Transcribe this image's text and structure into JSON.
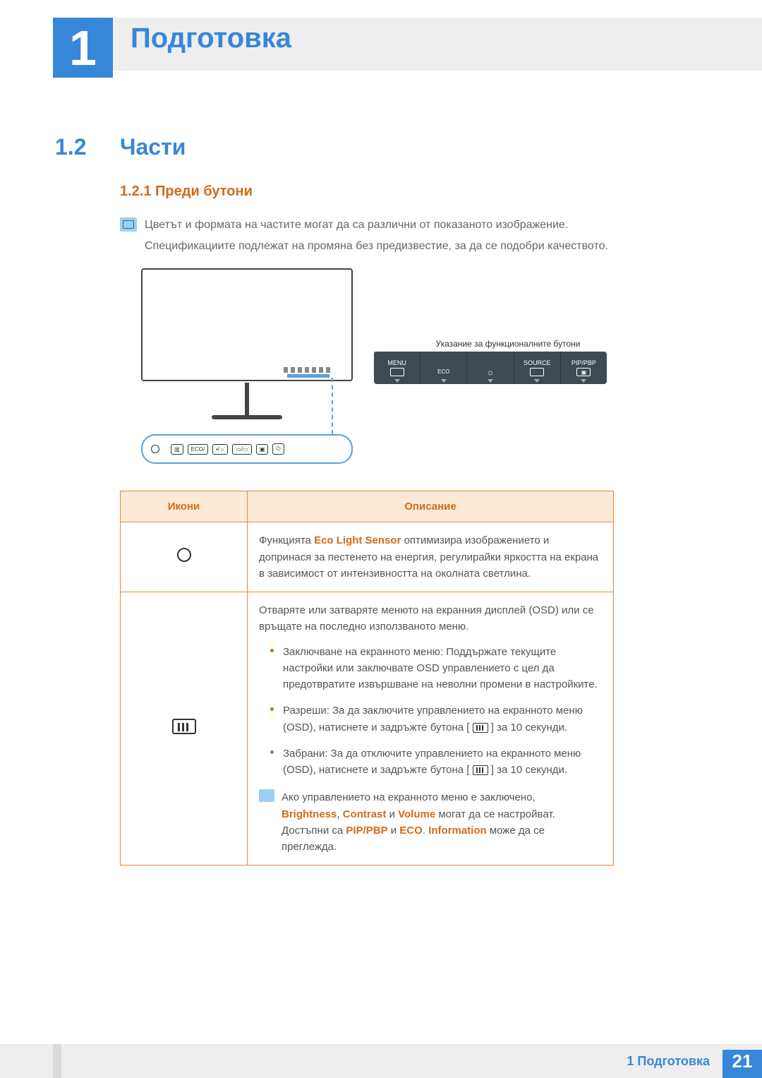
{
  "chapter": {
    "number": "1",
    "title": "Подготовка"
  },
  "section": {
    "number": "1.2",
    "title": "Части"
  },
  "subsection": {
    "full": "1.2.1  Преди бутони"
  },
  "note": {
    "line1": "Цветът и формата на частите могат да са различни от показаното изображение.",
    "line2": "Спецификациите подлежат на промяна без предизвестие, за да се подобри качеството."
  },
  "diagram": {
    "panel_guide": "Указание за функционалните бутони",
    "top_buttons": [
      {
        "label": "MENU"
      },
      {
        "label": "ECO"
      },
      {
        "label": ""
      },
      {
        "label": "SOURCE"
      },
      {
        "label": "PIP/PBP"
      }
    ],
    "bottom_buttons": [
      "",
      "ECO/",
      "/",
      "/",
      "",
      ""
    ]
  },
  "table": {
    "headers": {
      "icons": "Икони",
      "desc": "Описание"
    },
    "rows": [
      {
        "icon": "sensor-circle",
        "desc": {
          "prefix": "Функцията ",
          "hl1": "Eco Light Sensor",
          "rest": " оптимизира изображението и допринася за пестенето на енергия, регулирайки яркостта на екрана в зависимост от интензивността на околната светлина."
        }
      },
      {
        "icon": "menu-rect",
        "desc": {
          "intro": "Отваряте или затваряте менюто на екранния дисплей (OSD) или се връщате на последно използваното меню.",
          "items": [
            "Заключване на екранното меню: Поддържате текущите настройки или заключвате OSD управлението с цел да предотвратите извършване на неволни промени в настройките.",
            "Разреши: За да заключите управлението на екранното меню (OSD), натиснете и задръжте бутона [  ] за 10 секунди.",
            "Забрани: За да отключите управлението на екранното меню (OSD), натиснете и задръжте бутона [  ] за 10 секунди."
          ],
          "note_line1": "Ако управлението на екранното меню е заключено,",
          "note_hl_b": "Brightness",
          "note_hl_c": "Contrast",
          "note_hl_v": "Volume",
          "note_mid": " могат да се настройват. Достъпни са ",
          "note_hl_p": "PIP/PBP",
          "note_hl_e": "ECO",
          "note_hl_i": "Information",
          "note_end": " може да се преглежда."
        }
      }
    ]
  },
  "footer": {
    "label": "1 Подготовка",
    "page": "21"
  }
}
